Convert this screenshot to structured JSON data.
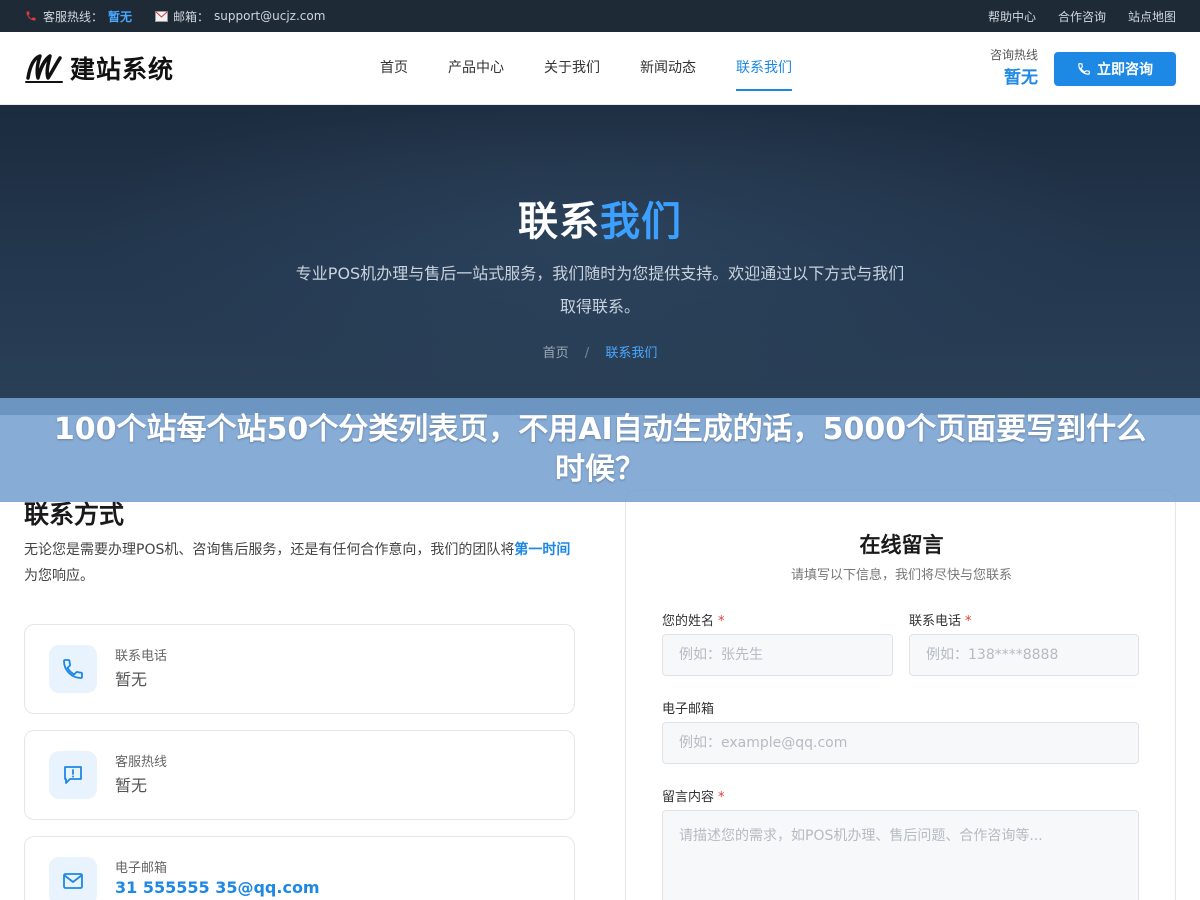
{
  "topbar": {
    "service_label": "客服热线：",
    "service_value": "暂无",
    "email_label": "邮箱：",
    "email_value": "support@ucjz.com",
    "links": [
      "帮助中心",
      "合作咨询",
      "站点地图"
    ]
  },
  "header": {
    "logo_text": "建站系统",
    "nav": [
      "首页",
      "产品中心",
      "关于我们",
      "新闻动态",
      "联系我们"
    ],
    "active_nav": "联系我们",
    "hotline_label": "咨询热线",
    "hotline_value": "暂无",
    "consult_button": "立即咨询"
  },
  "hero": {
    "title_main": "联系",
    "title_accent": "我们",
    "description": "专业POS机办理与售后一站式服务，我们随时为您提供支持。欢迎通过以下方式与我们取得联系。",
    "breadcrumb_home": "首页",
    "breadcrumb_sep": "/",
    "breadcrumb_current": "联系我们"
  },
  "overlay": {
    "text": "100个站每个站50个分类列表页，不用AI自动生成的话，5000个页面要写到什么时候？"
  },
  "contact": {
    "title": "联系方式",
    "desc_start": "无论您是需要办理POS机、咨询售后服务，还是有任何合作意向，我们的团队将",
    "desc_highlight": "第一时间",
    "desc_end": "为您响应。",
    "cards": [
      {
        "label": "联系电话",
        "value": "暂无",
        "icon": "phone-icon"
      },
      {
        "label": "客服热线",
        "value": "暂无",
        "icon": "chat-icon"
      },
      {
        "label": "电子邮箱",
        "value": "31 555555 35@qq.com",
        "icon": "mail-icon"
      }
    ]
  },
  "form": {
    "title": "在线留言",
    "subtitle": "请填写以下信息，我们将尽快与您联系",
    "name_label": "您的姓名",
    "name_placeholder": "例如：张先生",
    "phone_label": "联系电话",
    "phone_placeholder": "例如：138****8888",
    "email_label": "电子邮箱",
    "email_placeholder": "例如：example@qq.com",
    "message_label": "留言内容",
    "message_placeholder": "请描述您的需求，如POS机办理、售后问题、合作咨询等...",
    "required_mark": "*"
  },
  "colors": {
    "accent": "#1e88e5",
    "topbar_bg": "#1f2a37",
    "hero_bg": "#1c2b3e",
    "overlay_bg": "#76a0d0"
  }
}
